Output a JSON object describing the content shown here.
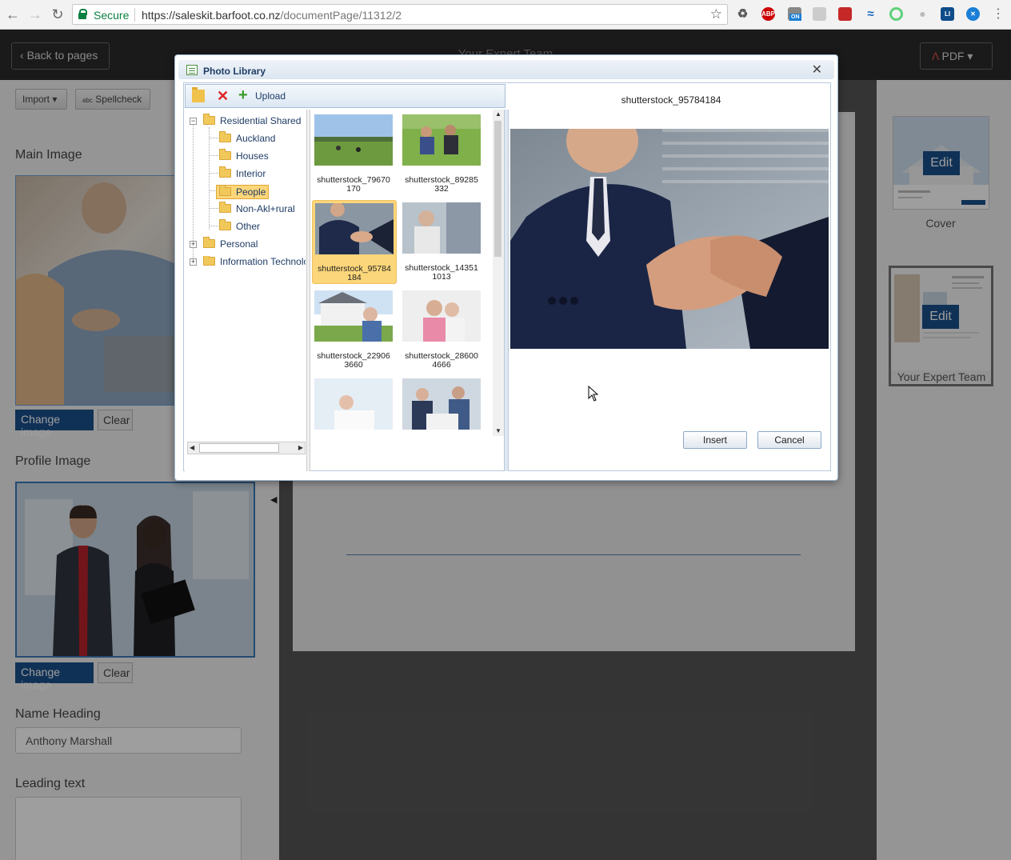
{
  "browser": {
    "secure_label": "Secure",
    "url_host": "https://saleskit.barfoot.co.nz",
    "url_path": "/documentPage/11312/2",
    "extensions": [
      "recycle-icon",
      "adblock-plus-icon",
      "on-toggle-icon",
      "ext-gray-icon",
      "ext-red-icon",
      "ext-wave-icon",
      "ext-circle-icon",
      "ext-bulb-icon",
      "ext-li-icon",
      "ext-blue-icon"
    ],
    "adblock_label": "ABP",
    "on_label": "ON"
  },
  "header": {
    "back_label": "Back to pages",
    "title": "Your Expert Team",
    "pdf_label": "PDF"
  },
  "left": {
    "import_label": "Import",
    "spellcheck_label": "Spellcheck",
    "main_image_label": "Main Image",
    "change_image_label": "Change image",
    "clear_label": "Clear",
    "profile_image_label": "Profile Image",
    "name_heading_label": "Name Heading",
    "name_value": "Anthony Marshall",
    "leading_text_label": "Leading text",
    "leading_text_value": ""
  },
  "right": {
    "pages": [
      {
        "label": "Cover",
        "edit": "Edit"
      },
      {
        "label": "Your Expert Team",
        "edit": "Edit"
      }
    ]
  },
  "dialog": {
    "title": "Photo Library",
    "upload_label": "Upload",
    "tree": {
      "root": "Residential Shared",
      "children": [
        "Auckland",
        "Houses",
        "Interior",
        "People",
        "Non-Akl+rural",
        "Other"
      ],
      "selected": "People",
      "siblings": [
        "Personal",
        "Information Technology"
      ]
    },
    "photos": [
      {
        "name": "shutterstock_79670170",
        "line1": "shutterstock_79670",
        "line2": "170"
      },
      {
        "name": "shutterstock_89285332",
        "line1": "shutterstock_89285",
        "line2": "332"
      },
      {
        "name": "shutterstock_95784184",
        "line1": "shutterstock_95784",
        "line2": "184"
      },
      {
        "name": "shutterstock_143511013",
        "line1": "shutterstock_14351",
        "line2": "1013"
      },
      {
        "name": "shutterstock_229063660",
        "line1": "shutterstock_22906",
        "line2": "3660"
      },
      {
        "name": "shutterstock_286004666",
        "line1": "shutterstock_28600",
        "line2": "4666"
      }
    ],
    "preview_name": "shutterstock_95784184",
    "insert_label": "Insert",
    "cancel_label": "Cancel"
  }
}
